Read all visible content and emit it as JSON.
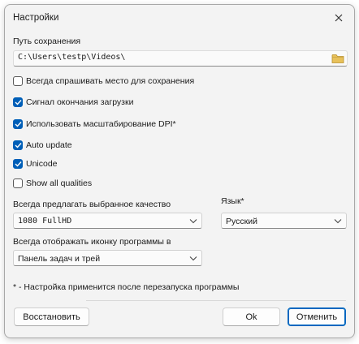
{
  "window": {
    "title": "Настройки",
    "close_icon": "close-icon"
  },
  "save_path": {
    "label": "Путь сохранения",
    "value": "C:\\Users\\testp\\Videos\\",
    "folder_icon": "folder-icon"
  },
  "checkboxes": [
    {
      "label": "Всегда спрашивать место для сохранения",
      "checked": false
    },
    {
      "label": "Сигнал окончания загрузки",
      "checked": true
    },
    {
      "label": "Использовать масштабирование DPI*",
      "checked": true
    },
    {
      "label": "Auto update",
      "checked": true
    },
    {
      "label": "Unicode",
      "checked": true
    },
    {
      "label": "Show all qualities",
      "checked": false
    }
  ],
  "quality": {
    "label": "Всегда предлагать выбранное качество",
    "value": "1080 FullHD"
  },
  "language": {
    "label": "Язык*",
    "value": "Русский"
  },
  "tray_icon": {
    "label": "Всегда отображать иконку программы в",
    "value": "Панель задач и трей"
  },
  "note": "* - Настройка применится после перезапуска программы",
  "buttons": {
    "restore": "Восстановить",
    "ok": "Ok",
    "cancel": "Отменить"
  },
  "colors": {
    "accent": "#005fb8",
    "dialog_bg": "#f3f3f3"
  }
}
